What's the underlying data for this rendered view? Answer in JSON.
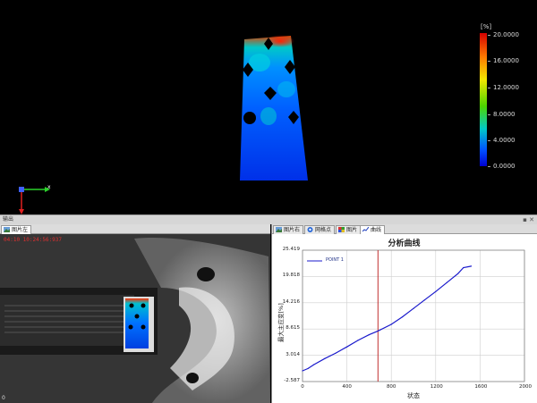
{
  "viewport": {
    "axis_x_label": "x",
    "colorbar": {
      "unit": "[%]",
      "ticks": [
        "20.0000",
        "16.0000",
        "12.0000",
        "8.0000",
        "4.0000",
        "0.0000"
      ],
      "colors": [
        "#d40000",
        "#ff7a00",
        "#f2e600",
        "#4cd600",
        "#00c8c8",
        "#0050ff",
        "#0000d0"
      ]
    }
  },
  "output": {
    "title": "输出",
    "controls": "▪ ✕"
  },
  "left_pane": {
    "tabs": [
      {
        "label": "图片左",
        "active": true
      }
    ],
    "timestamp": "04:10 10:24:56:937",
    "corner_label": "0"
  },
  "right_pane": {
    "tabs": [
      {
        "label": "图片右",
        "icon": "image-icon"
      },
      {
        "label": "网格点",
        "icon": "grid-icon"
      },
      {
        "label": "图片",
        "icon": "image-icon"
      },
      {
        "label": "曲线",
        "icon": "curve-icon",
        "active": true
      }
    ]
  },
  "chart_data": {
    "type": "line",
    "title": "分析曲线",
    "xlabel": "状态",
    "ylabel": "最大主应变[%]",
    "xlim": [
      0,
      2000
    ],
    "ylim": [
      -2.587,
      25.419
    ],
    "x_ticks": [
      "0",
      "400",
      "800",
      "1200",
      "1600",
      "2000"
    ],
    "y_ticks": [
      "25.419",
      "19.818",
      "14.216",
      "8.615",
      "3.014",
      "-2.587"
    ],
    "grid": true,
    "legend_position": "top-left",
    "marker_x": 680,
    "series": [
      {
        "name": "POINT 1",
        "color": "#1a1acc",
        "x": [
          0,
          50,
          100,
          200,
          300,
          400,
          500,
          600,
          680,
          800,
          900,
          1000,
          1100,
          1200,
          1300,
          1400,
          1450,
          1520
        ],
        "y": [
          -0.3,
          0.2,
          1.0,
          2.3,
          3.5,
          4.8,
          6.2,
          7.4,
          8.2,
          9.6,
          11.2,
          13.0,
          14.8,
          16.6,
          18.5,
          20.4,
          21.7,
          22.0
        ]
      }
    ]
  }
}
